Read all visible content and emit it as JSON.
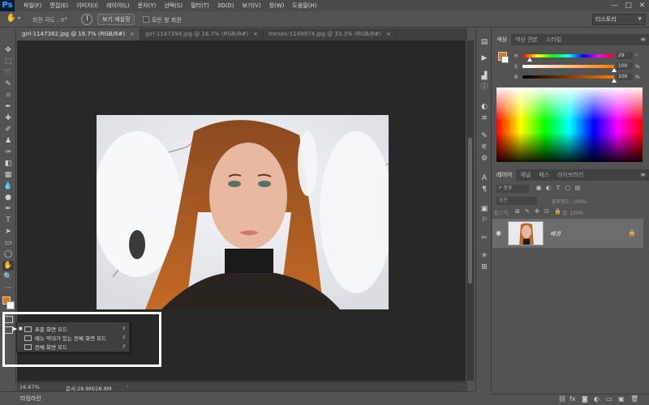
{
  "app": {
    "logo": "Ps"
  },
  "menu": [
    "파일(F)",
    "편집(E)",
    "이미지(I)",
    "레이어(L)",
    "문자(Y)",
    "선택(S)",
    "필터(T)",
    "3D(D)",
    "보기(V)",
    "창(W)",
    "도움말(H)"
  ],
  "window_controls": {
    "minimize": "—",
    "maximize": "□",
    "close": "✕"
  },
  "options": {
    "rotate_label": "회전 각도 : 0°",
    "reset_view": "보기 재설정",
    "rotate_all_windows": "모든 창 회전",
    "workspace": "티스토리"
  },
  "tabs": [
    {
      "label": "girl-1147382.jpg @ 16.7% (RGB/8#)",
      "close": "×"
    },
    {
      "label": "girl-1147394.jpg @ 16.7% (RGB/8#)",
      "close": "×"
    },
    {
      "label": "horses-1149974.jpg @ 33.3% (RGB/8#)",
      "close": "×"
    }
  ],
  "status": {
    "zoom": "16.67%",
    "doc_info": "문서:28.8M/28.8M",
    "timeline": "타임라인"
  },
  "screen_mode_menu": [
    {
      "label": "표준 화면 모드",
      "key": "F"
    },
    {
      "label": "메뉴 막대가 있는 전체 화면 모드",
      "key": "F"
    },
    {
      "label": "전체 화면 모드",
      "key": "F"
    }
  ],
  "color_panel": {
    "tabs": [
      "색상",
      "색상 견본",
      "스타일"
    ],
    "h_label": "H",
    "h_value": "29",
    "h_unit": "°",
    "s_label": "S",
    "s_value": "100",
    "s_unit": "%",
    "b_label": "B",
    "b_value": "100",
    "b_unit": "%",
    "h_fraction": 0.08,
    "s_fraction": 1.0,
    "b_fraction": 1.0,
    "foreground_color": "#e8720c",
    "background_color": "#ffffff"
  },
  "layers_panel": {
    "tabs": [
      "레이어",
      "채널",
      "패스",
      "라이브러리"
    ],
    "filter_placeholder": "P 종류",
    "blend_mode": "표준",
    "opacity_label": "불투명도: 100%",
    "lock_label": "잠그기:",
    "fill_label": "칠: 100%",
    "layer_name": "배경"
  },
  "icons": {
    "panel_bottom": [
      "link-icon",
      "fx-icon",
      "mask-icon",
      "adjustment-icon",
      "group-icon",
      "new-layer-icon",
      "delete-icon"
    ]
  }
}
